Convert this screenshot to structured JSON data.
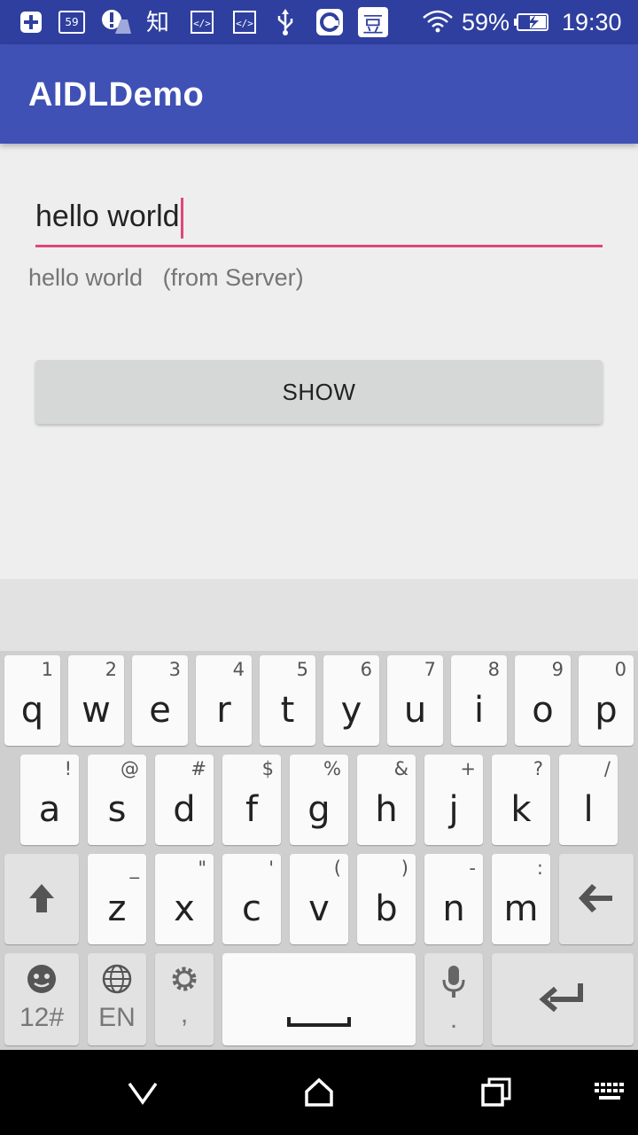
{
  "status_bar": {
    "notification_59": "59",
    "zhi_char": "知",
    "dou_char": "豆",
    "battery_percent": "59%",
    "time": "19:30"
  },
  "app": {
    "title": "AIDLDemo"
  },
  "content": {
    "input_value": "hello world",
    "result_text": "hello world   (from Server)",
    "show_button_label": "SHOW"
  },
  "keyboard": {
    "row1": [
      {
        "main": "q",
        "hint": "1"
      },
      {
        "main": "w",
        "hint": "2"
      },
      {
        "main": "e",
        "hint": "3"
      },
      {
        "main": "r",
        "hint": "4"
      },
      {
        "main": "t",
        "hint": "5"
      },
      {
        "main": "y",
        "hint": "6"
      },
      {
        "main": "u",
        "hint": "7"
      },
      {
        "main": "i",
        "hint": "8"
      },
      {
        "main": "o",
        "hint": "9"
      },
      {
        "main": "p",
        "hint": "0"
      }
    ],
    "row2": [
      {
        "main": "a",
        "hint": "!"
      },
      {
        "main": "s",
        "hint": "@"
      },
      {
        "main": "d",
        "hint": "#"
      },
      {
        "main": "f",
        "hint": "$"
      },
      {
        "main": "g",
        "hint": "%"
      },
      {
        "main": "h",
        "hint": "&"
      },
      {
        "main": "j",
        "hint": "+"
      },
      {
        "main": "k",
        "hint": "?"
      },
      {
        "main": "l",
        "hint": "/"
      }
    ],
    "row3": [
      {
        "main": "z",
        "hint": "_"
      },
      {
        "main": "x",
        "hint": "\""
      },
      {
        "main": "c",
        "hint": "'"
      },
      {
        "main": "v",
        "hint": "("
      },
      {
        "main": "b",
        "hint": ")"
      },
      {
        "main": "n",
        "hint": "-"
      },
      {
        "main": "m",
        "hint": ":"
      }
    ],
    "symbols_label": "12#",
    "language_label": "EN",
    "comma_label": ",",
    "period_label": "."
  },
  "icons": {
    "shift": "shift-arrow-icon",
    "backspace": "backspace-icon",
    "emoji": "emoji-icon",
    "globe": "globe-icon",
    "settings": "gear-icon",
    "mic": "mic-icon",
    "enter": "enter-icon",
    "space": "space-bar-icon"
  },
  "colors": {
    "status_bar": "#2f3f9f",
    "app_bar": "#3f51b5",
    "accent": "#e0467c",
    "button": "#d6d7d7"
  }
}
